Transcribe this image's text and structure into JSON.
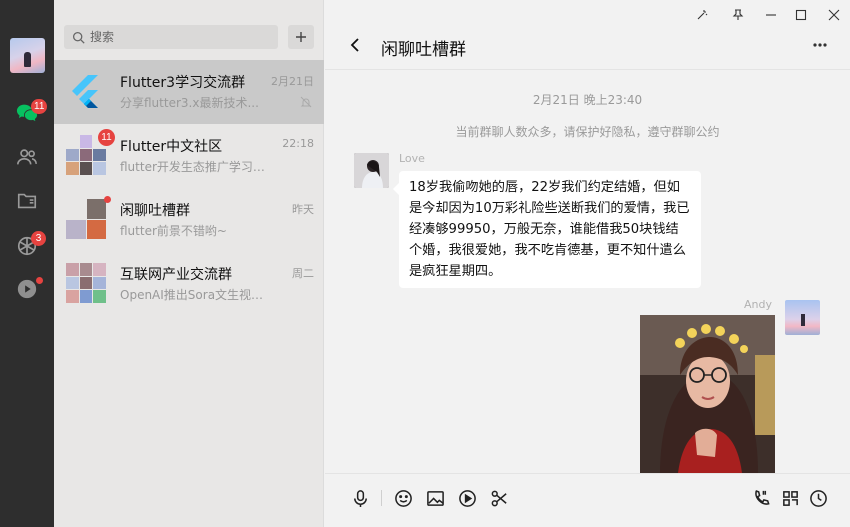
{
  "app": {
    "colors": {
      "rail": "#2e2e2e",
      "list_bg": "#e8e7e6",
      "active_row": "#c9c9c9",
      "chat_bg": "#f2f2f2",
      "badge": "#e64340"
    }
  },
  "rail": {
    "icons": [
      "chat-icon",
      "contacts-icon",
      "folder-icon",
      "moments-icon",
      "video-icon"
    ],
    "chat_badge": "11",
    "moments_badge": "3"
  },
  "search": {
    "placeholder": "搜索"
  },
  "conversations": [
    {
      "name": "Flutter3学习交流群",
      "time": "2月21日",
      "preview": "分享flutter3.x最新技术...",
      "muted": true,
      "active": true
    },
    {
      "name": "Flutter中文社区",
      "time": "22:18",
      "preview": "flutter开发生态推广学习交...",
      "badge": "11"
    },
    {
      "name": "闲聊吐槽群",
      "time": "昨天",
      "preview": "flutter前景不错哟~",
      "dot": true
    },
    {
      "name": "互联网产业交流群",
      "time": "周二",
      "preview": "OpenAI推出Sora文生视频大..."
    }
  ],
  "chat": {
    "title": "闲聊吐槽群",
    "timestamp": "2月21日 晚上23:40",
    "system_note": "当前群聊人数众多，请保护好隐私，遵守群聊公约",
    "messages": [
      {
        "sender": "Love",
        "text": "18岁我偷吻她的唇，22岁我们约定结婚，但如是今却因为10万彩礼险些送断我们的爱情，我已经凑够99950，万般无奈，谁能借我50块钱结个婚，我很爱她，我不吃肯德基，更不知什遣么是疯狂星期四。"
      },
      {
        "sender": "Andy",
        "type": "image"
      }
    ]
  },
  "toolbar": {
    "left": [
      "microphone-icon",
      "emoji-icon",
      "image-icon",
      "play-icon",
      "scissors-icon"
    ],
    "right": [
      "phone-icon",
      "grid-icon",
      "clock-icon"
    ]
  }
}
